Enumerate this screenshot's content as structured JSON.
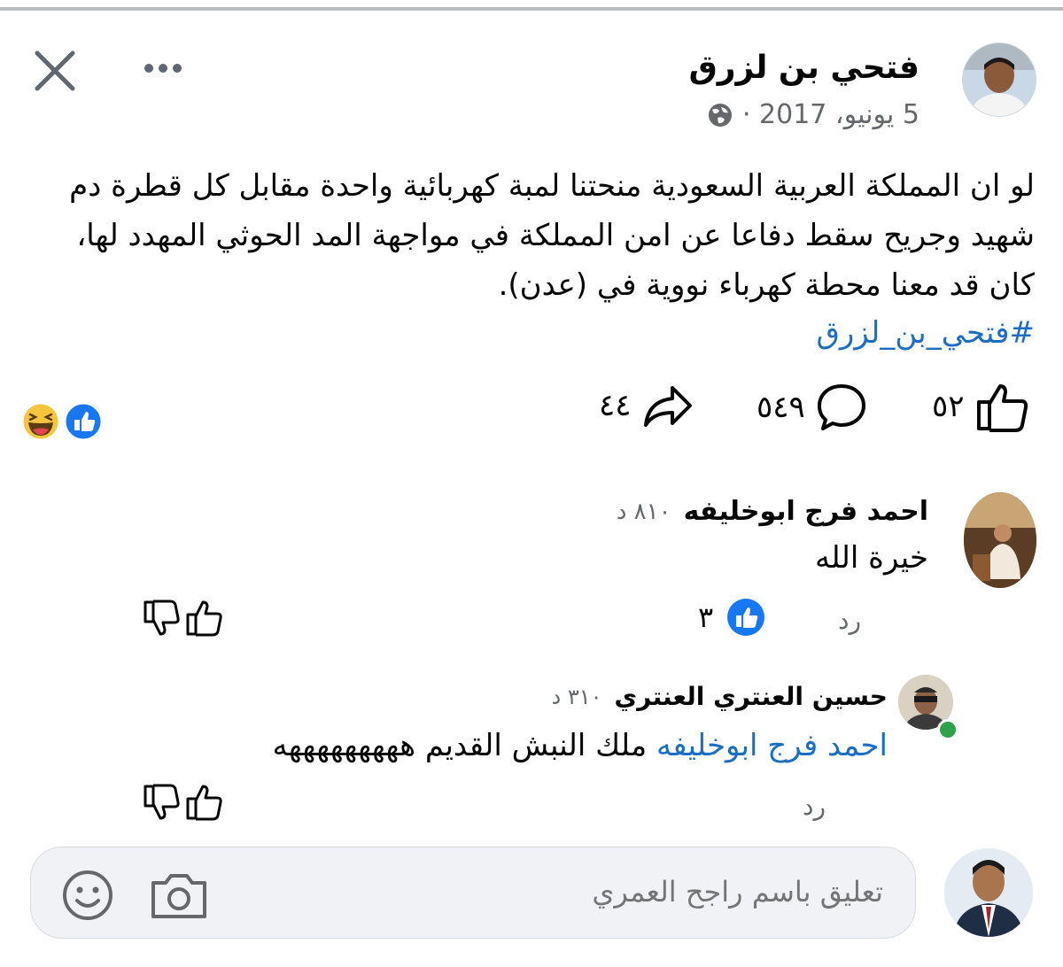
{
  "post": {
    "author": "فتحي بن لزرق",
    "date": "5 يونيو، 2017 ·",
    "body": "لو ان المملكة العربية السعودية منحتنا لمبة كهربائية واحدة مقابل كل قطرة دم شهيد وجريح سقط دفاعا عن امن المملكة في مواجهة المد الحوثي المهدد لها، كان قد معنا محطة كهرباء نووية في (عدن).",
    "hashtag": "#فتحي_بن_لزرق",
    "likes": "٥٢",
    "comments": "٥٤٩",
    "shares": "٤٤",
    "reaction_types": [
      "like-icon",
      "laugh-icon"
    ]
  },
  "comments": [
    {
      "author": "احمد فرج ابوخليفه",
      "time": "٨١٠ د",
      "text": "خيرة الله",
      "reply_label": "رد",
      "reaction_count": "٣"
    },
    {
      "author": "حسين العنتري العنتري",
      "time": "٣١٠ د",
      "mention": "احمد فرج ابوخليفه",
      "text": "ملك النبش القديم هههههههههه",
      "reply_label": "رد"
    }
  ],
  "composer": {
    "placeholder": "تعليق باسم راجح العمري"
  },
  "colors": {
    "link": "#1b6ec2",
    "meta": "#65676b",
    "like_blue": "#1877f2",
    "online": "#31a24c"
  }
}
